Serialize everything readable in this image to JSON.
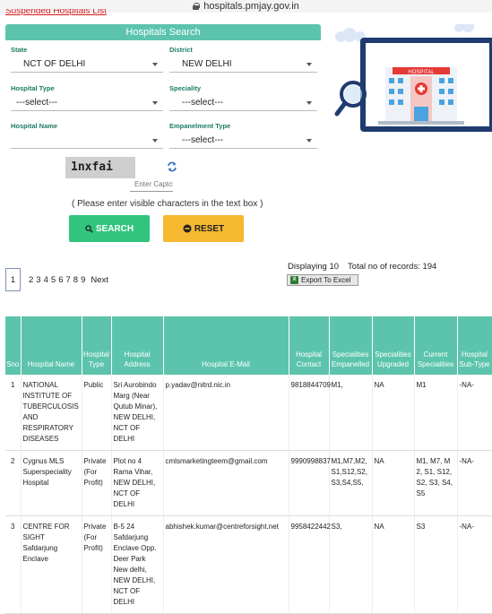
{
  "browser": {
    "url": "hospitals.pmjay.gov.in"
  },
  "top_link": {
    "label": "Suspended Hospitals List"
  },
  "search": {
    "title": "Hospitals Search",
    "state": {
      "label": "State",
      "value": "NCT OF DELHI"
    },
    "district": {
      "label": "District",
      "value": "NEW DELHI"
    },
    "hospital_type": {
      "label": "Hospital Type",
      "value": "---select---"
    },
    "speciality": {
      "label": "Speciality",
      "value": "---select---"
    },
    "hospital_name": {
      "label": "Hospital Name",
      "value": ""
    },
    "empanelment_type": {
      "label": "Empanelment Type",
      "value": "---select---"
    },
    "captcha": {
      "code": "1nxfai",
      "placeholder": "Enter Captcha"
    },
    "hint": "( Please enter visible characters in the text box )",
    "search_label": "SEARCH",
    "reset_label": "RESET"
  },
  "illustration": {
    "sign": "HOSPITAL"
  },
  "pagination": {
    "current": "1",
    "pages": [
      "2",
      "3",
      "4",
      "5",
      "6",
      "7",
      "8",
      "9"
    ],
    "next": "Next"
  },
  "records": {
    "displaying": "Displaying 10",
    "total": "Total no of records: 194",
    "export_label": "Export To Excel"
  },
  "table": {
    "headers": [
      "Sno",
      "Hospital Name",
      "Hospital Type",
      "Hospital Address",
      "Hospital E-Mail",
      "Hospital Contact",
      "Specialities Empanelled",
      "Specialities Upgraded",
      "Current Specialities",
      "Hospital Sub-Type"
    ],
    "rows": [
      {
        "sno": "1",
        "name": "NATIONAL INSTITUTE OF TUBERCULOSIS AND RESPIRATORY DISEASES",
        "type": "Public",
        "address": "Sri Aurobindo Marg (Near Qutub Minar), NEW DELHI, NCT OF DELHI",
        "email": "p.yadav@nitrd.nic.in",
        "contact": "9818844709",
        "emp": "M1,",
        "upg": "NA",
        "cur": "M1",
        "sub": "-NA-"
      },
      {
        "sno": "2",
        "name": "Cygnus MLS Superspeciality Hospital",
        "type": "Private (For Profit)",
        "address": "Plot no 4 Rama Vihar, NEW DELHI, NCT OF DELHI",
        "email": "cmlsmarketingteem@gmail.com",
        "contact": "9990998837",
        "emp": "M1,M7,M2, S1,S12,S2, S3,S4,S5,",
        "upg": "NA",
        "cur": "M1, M7, M 2, S1, S12, S2, S3, S4, S5",
        "sub": "-NA-"
      },
      {
        "sno": "3",
        "name": "CENTRE FOR SIGHT Safdarjung Enclave",
        "type": "Private (For Profit)",
        "address": "B-5 24 Safdarjung Enclave Opp. Deer Park New delhi, NEW DELHI, NCT OF DELHI",
        "email": "abhishek.kumar@centreforsight.net",
        "contact": "9958422442",
        "emp": "S3,",
        "upg": "NA",
        "cur": "S3",
        "sub": "-NA-"
      }
    ]
  },
  "colors": {
    "accent": "#5cc4ac",
    "search_btn": "#31c47d",
    "reset_btn": "#f7b832",
    "link_red": "#d21c1c"
  }
}
